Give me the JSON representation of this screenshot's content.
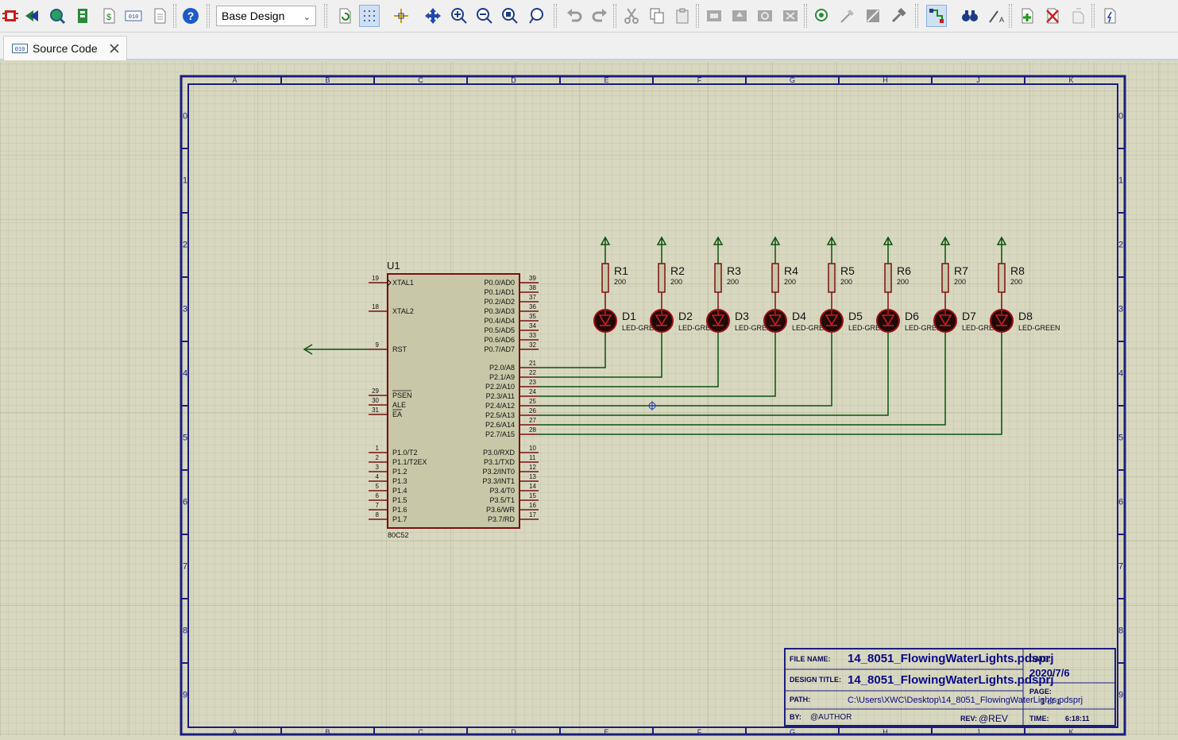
{
  "toolbar": {
    "design_select": "Base Design"
  },
  "tab": {
    "label": "Source Code"
  },
  "sheet": {
    "cols": [
      "A",
      "B",
      "C",
      "D",
      "E",
      "F",
      "G",
      "H",
      "J",
      "K"
    ],
    "rows": [
      "0",
      "1",
      "2",
      "3",
      "4",
      "5",
      "6",
      "7",
      "8",
      "9"
    ]
  },
  "mcu": {
    "ref": "U1",
    "part": "80C52",
    "left_pins": [
      {
        "num": "19",
        "name": "XTAL1"
      },
      {
        "num": "18",
        "name": "XTAL2"
      },
      {
        "num": "9",
        "name": "RST"
      },
      {
        "num": "29",
        "name": "PSEN"
      },
      {
        "num": "30",
        "name": "ALE"
      },
      {
        "num": "31",
        "name": "EA"
      },
      {
        "num": "1",
        "name": "P1.0/T2"
      },
      {
        "num": "2",
        "name": "P1.1/T2EX"
      },
      {
        "num": "3",
        "name": "P1.2"
      },
      {
        "num": "4",
        "name": "P1.3"
      },
      {
        "num": "5",
        "name": "P1.4"
      },
      {
        "num": "6",
        "name": "P1.5"
      },
      {
        "num": "7",
        "name": "P1.6"
      },
      {
        "num": "8",
        "name": "P1.7"
      }
    ],
    "right_pins": [
      {
        "num": "39",
        "name": "P0.0/AD0"
      },
      {
        "num": "38",
        "name": "P0.1/AD1"
      },
      {
        "num": "37",
        "name": "P0.2/AD2"
      },
      {
        "num": "36",
        "name": "P0.3/AD3"
      },
      {
        "num": "35",
        "name": "P0.4/AD4"
      },
      {
        "num": "34",
        "name": "P0.5/AD5"
      },
      {
        "num": "33",
        "name": "P0.6/AD6"
      },
      {
        "num": "32",
        "name": "P0.7/AD7"
      },
      {
        "num": "21",
        "name": "P2.0/A8"
      },
      {
        "num": "22",
        "name": "P2.1/A9"
      },
      {
        "num": "23",
        "name": "P2.2/A10"
      },
      {
        "num": "24",
        "name": "P2.3/A11"
      },
      {
        "num": "25",
        "name": "P2.4/A12"
      },
      {
        "num": "26",
        "name": "P2.5/A13"
      },
      {
        "num": "27",
        "name": "P2.6/A14"
      },
      {
        "num": "28",
        "name": "P2.7/A15"
      },
      {
        "num": "10",
        "name": "P3.0/RXD"
      },
      {
        "num": "11",
        "name": "P3.1/TXD"
      },
      {
        "num": "12",
        "name": "P3.2/INT0"
      },
      {
        "num": "13",
        "name": "P3.3/INT1"
      },
      {
        "num": "14",
        "name": "P3.4/T0"
      },
      {
        "num": "15",
        "name": "P3.5/T1"
      },
      {
        "num": "16",
        "name": "P3.6/WR"
      },
      {
        "num": "17",
        "name": "P3.7/RD"
      }
    ]
  },
  "resistors": [
    {
      "ref": "R1",
      "value": "200"
    },
    {
      "ref": "R2",
      "value": "200"
    },
    {
      "ref": "R3",
      "value": "200"
    },
    {
      "ref": "R4",
      "value": "200"
    },
    {
      "ref": "R5",
      "value": "200"
    },
    {
      "ref": "R6",
      "value": "200"
    },
    {
      "ref": "R7",
      "value": "200"
    },
    {
      "ref": "R8",
      "value": "200"
    }
  ],
  "leds": [
    {
      "ref": "D1",
      "value": "LED-GREEN"
    },
    {
      "ref": "D2",
      "value": "LED-GREEN"
    },
    {
      "ref": "D3",
      "value": "LED-GREEN"
    },
    {
      "ref": "D4",
      "value": "LED-GREEN"
    },
    {
      "ref": "D5",
      "value": "LED-GREEN"
    },
    {
      "ref": "D6",
      "value": "LED-GREEN"
    },
    {
      "ref": "D7",
      "value": "LED-GREEN"
    },
    {
      "ref": "D8",
      "value": "LED-GREEN"
    }
  ],
  "title_block": {
    "file_name_label": "FILE NAME:",
    "file_name": "14_8051_FlowingWaterLights.pdsprj",
    "design_title_label": "DESIGN TITLE:",
    "design_title": "14_8051_FlowingWaterLights.pdsprj",
    "path_label": "PATH:",
    "path": "C:\\Users\\XWC\\Desktop\\14_8051_FlowingWaterLights.pdsprj",
    "by_label": "BY:",
    "by": "@AUTHOR",
    "rev_label": "REV:",
    "rev": "@REV",
    "date_label": "DATE:",
    "date": "2020/7/6",
    "page_label": "PAGE:",
    "page": "1 of 1",
    "time_label": "TIME:",
    "time": "6:18:11"
  },
  "colors": {
    "grid_bg": "#d8d8c0",
    "grid_line": "#c8c8b0",
    "sheet_border": "#1c1c80",
    "wire": "#0a520a",
    "body": "#c8c8a8",
    "body_stroke": "#7a1010"
  }
}
